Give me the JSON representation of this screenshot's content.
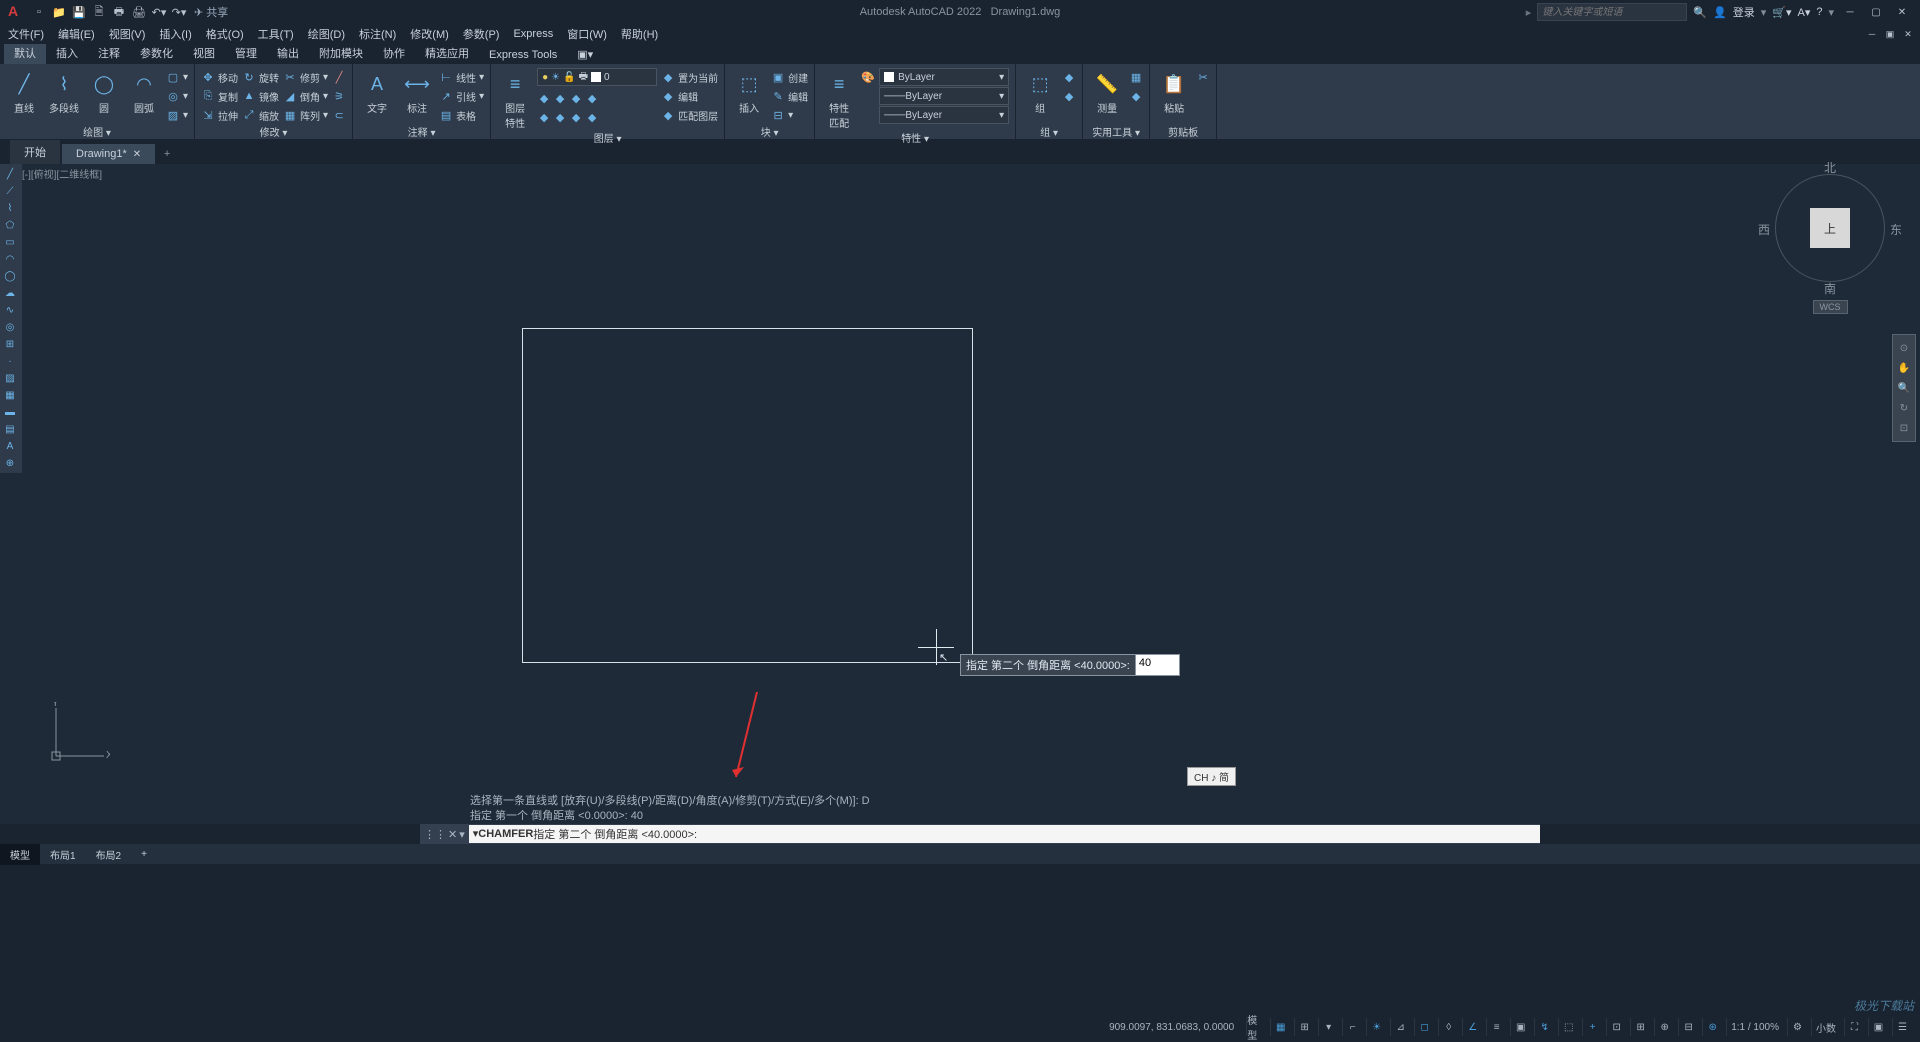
{
  "title": {
    "app": "Autodesk AutoCAD 2022",
    "file": "Drawing1.dwg",
    "share": "共享"
  },
  "qat_icons": [
    "new",
    "open",
    "save",
    "saveall",
    "plot",
    "print",
    "undo",
    "redo"
  ],
  "search_placeholder": "键入关键字或短语",
  "login": "登录",
  "menubar": [
    "文件(F)",
    "编辑(E)",
    "视图(V)",
    "插入(I)",
    "格式(O)",
    "工具(T)",
    "绘图(D)",
    "标注(N)",
    "修改(M)",
    "参数(P)",
    "Express",
    "窗口(W)",
    "帮助(H)"
  ],
  "ribbon_tabs": [
    "默认",
    "插入",
    "注释",
    "参数化",
    "视图",
    "管理",
    "输出",
    "附加模块",
    "协作",
    "精选应用",
    "Express Tools"
  ],
  "panels": {
    "draw": {
      "title": "绘图 ▾",
      "line": "直线",
      "pline": "多段线",
      "circle": "圆",
      "arc": "圆弧"
    },
    "modify": {
      "title": "修改 ▾",
      "move": "移动",
      "rotate": "旋转",
      "trim": "修剪",
      "copy": "复制",
      "mirror": "镜像",
      "fillet": "倒角",
      "stretch": "拉伸",
      "scale": "缩放",
      "array": "阵列"
    },
    "annot": {
      "title": "注释 ▾",
      "text": "文字",
      "dim": "标注",
      "linear": "线性",
      "leader": "引线",
      "table": "表格"
    },
    "layer": {
      "title": "图层 ▾",
      "props": "图层\n特性",
      "cur": "0",
      "setcurrent": "置为当前",
      "edit": "编辑",
      "match": "匹配图层"
    },
    "block": {
      "title": "块 ▾",
      "insert": "插入",
      "create": "创建",
      "edit": "编辑"
    },
    "props": {
      "title": "特性 ▾",
      "match": "特性\n匹配",
      "bylayer": "ByLayer"
    },
    "group": {
      "title": "组 ▾",
      "group": "组"
    },
    "util": {
      "title": "实用工具 ▾",
      "measure": "测量"
    },
    "clip": {
      "title": "剪贴板",
      "paste": "粘贴"
    }
  },
  "filetabs": {
    "start": "开始",
    "active": "Drawing1*"
  },
  "viewlabel": "[-][俯视][二维线框]",
  "viewcube": {
    "n": "北",
    "s": "南",
    "e": "东",
    "w": "西",
    "face": "上",
    "wcs": "WCS"
  },
  "ucs": {
    "x": "X",
    "y": "Y"
  },
  "dyninput": {
    "prompt": "指定 第二个 倒角距离 <40.0000>:",
    "value": "40"
  },
  "ime": "CH ♪ 简",
  "history": {
    "l1": "选择第一条直线或 [放弃(U)/多段线(P)/距离(D)/角度(A)/修剪(T)/方式(E)/多个(M)]: D",
    "l2": "指定 第一个 倒角距离 <0.0000>: 40"
  },
  "cmdline": {
    "cmd": "CHAMFER",
    "prompt": "指定 第二个 倒角距离 <40.0000>:"
  },
  "layouts": [
    "模型",
    "布局1",
    "布局2"
  ],
  "status": {
    "coord": "909.0097, 831.0683, 0.0000",
    "model": "模型",
    "scale": "1:1 / 100%",
    "decimal": "小数"
  },
  "watermark": "极光下载站"
}
